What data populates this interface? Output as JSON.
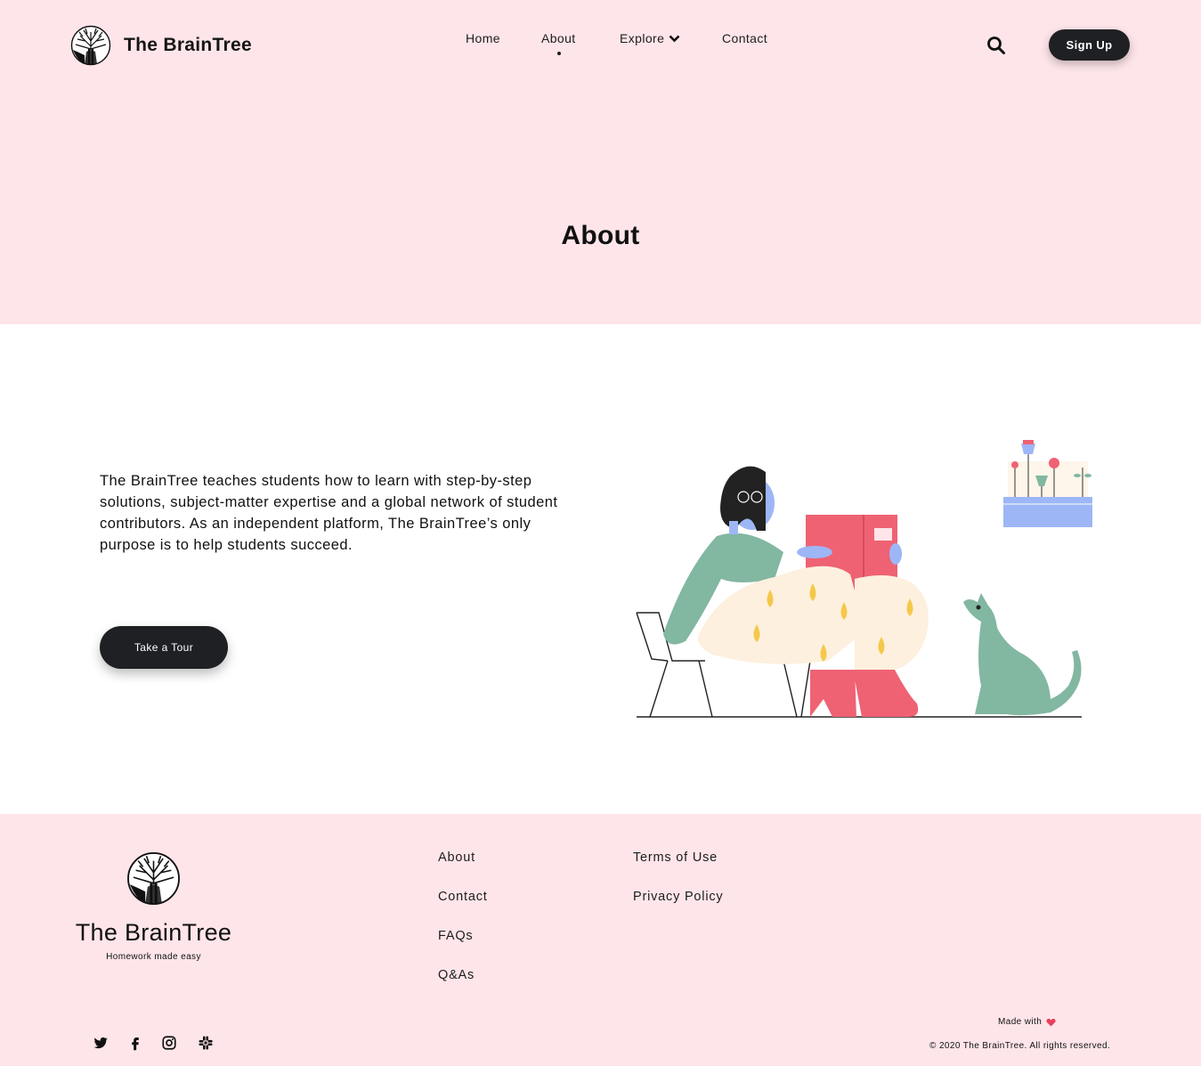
{
  "brand": {
    "name": "The BrainTree"
  },
  "nav": {
    "items": [
      "Home",
      "About",
      "Explore",
      "Contact"
    ],
    "active": "About"
  },
  "header": {
    "signup_label": "Sign Up"
  },
  "hero": {
    "title": "About"
  },
  "about": {
    "text": "The BrainTree teaches students how to learn with step-by-step solutions, subject-matter expertise and a global network of student contributors. As an independent platform, The BrainTree’s only purpose is to help students succeed.",
    "cta_label": "Take a Tour"
  },
  "footer": {
    "brand": "The BrainTree",
    "tagline": "Homework made easy",
    "links_col1": [
      "About",
      "Contact",
      "FAQs",
      "Q&As"
    ],
    "links_col2": [
      "Terms of Use",
      "Privacy Policy"
    ],
    "social": [
      "twitter-icon",
      "facebook-icon",
      "instagram-icon",
      "slack-icon"
    ],
    "made_with": "Made with",
    "copyright": "© 2020 The BrainTree. All rights reserved."
  },
  "colors": {
    "pink_bg": "#fee5e9",
    "dark_button": "#1f2024",
    "heart": "#e8405a",
    "accent_green": "#82b7a2",
    "accent_red": "#ef6274",
    "accent_blue": "#9db6f6",
    "accent_yellow": "#f5c84a"
  }
}
